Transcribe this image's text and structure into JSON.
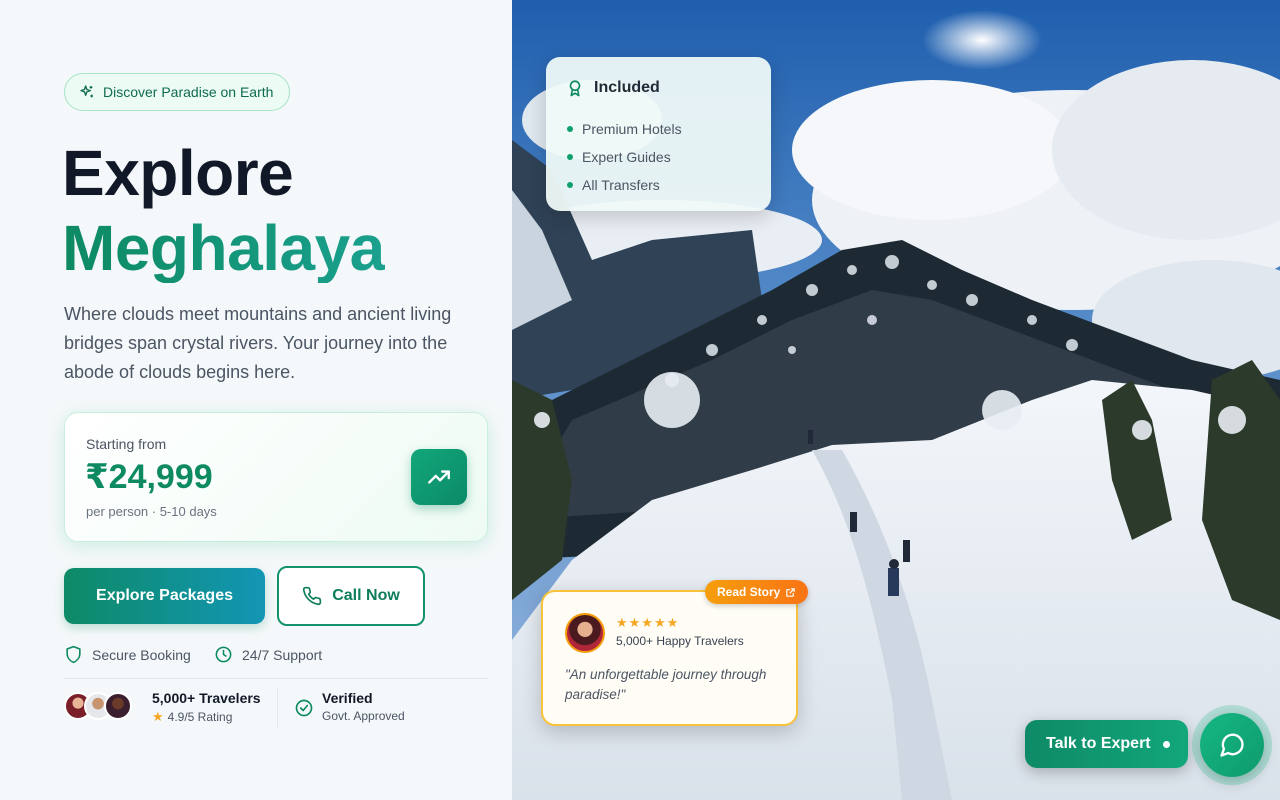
{
  "badge": {
    "label": "Discover Paradise on Earth",
    "icon": "sparkle-icon"
  },
  "hero": {
    "title_line1": "Explore",
    "title_line2": "Meghalaya",
    "description": "Where clouds meet mountains and ancient living bridges span crystal rivers. Your journey into the abode of clouds begins here."
  },
  "pricing": {
    "label": "Starting from",
    "amount": "₹24,999",
    "details": "per person · 5-10 days",
    "icon": "trending-up-icon"
  },
  "actions": {
    "primary_label": "Explore Packages",
    "secondary_label": "Call Now"
  },
  "features": [
    {
      "label": "Secure Booking",
      "icon": "shield-icon"
    },
    {
      "label": "24/7 Support",
      "icon": "clock-icon"
    }
  ],
  "social_proof": {
    "travelers": "5,000+ Travelers",
    "rating": "4.9/5 Rating",
    "verified_title": "Verified",
    "verified_sub": "Govt. Approved"
  },
  "included": {
    "title": "Included",
    "items": [
      "Premium Hotels",
      "Expert Guides",
      "All Transfers"
    ]
  },
  "review": {
    "stars": "★★★★★",
    "subtitle": "5,000+ Happy Travelers",
    "quote": "\"An unforgettable journey through paradise!\"",
    "read_story": "Read Story"
  },
  "contact": {
    "talk_label": "Talk to Expert",
    "chat_icon": "chat-bubble-icon"
  },
  "colors": {
    "brand_green": "#0d8a62",
    "accent_teal": "#1296b5",
    "star": "#f5a623",
    "orange": "#f97316"
  }
}
